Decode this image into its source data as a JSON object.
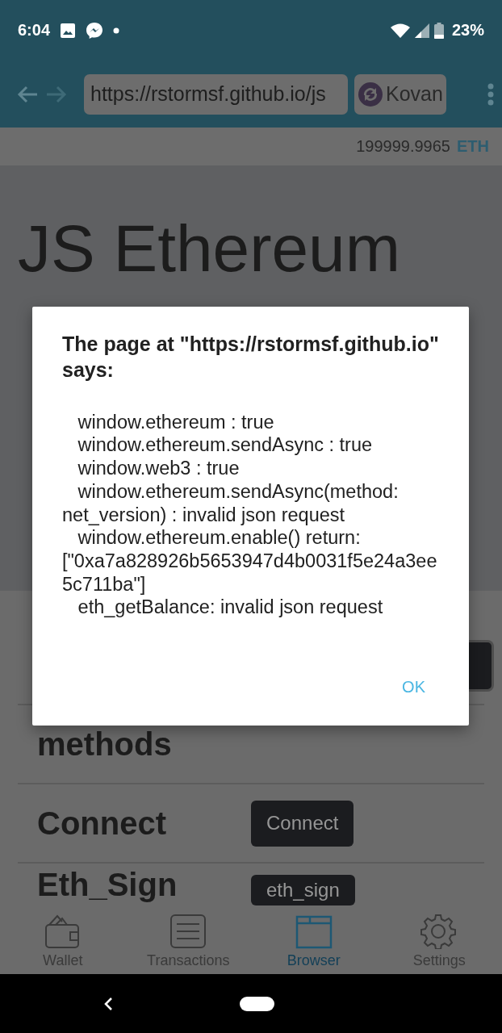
{
  "status_bar": {
    "time": "6:04",
    "battery": "23%"
  },
  "toolbar": {
    "url": "https://rstormsf.github.io/js",
    "network": "Kovan"
  },
  "balance": {
    "amount": "199999.9965",
    "unit": "ETH"
  },
  "page": {
    "title": "JS Ethereum",
    "rows": [
      {
        "heading": "methods"
      },
      {
        "heading": "Connect",
        "button": "Connect"
      },
      {
        "heading": "Eth_Sign",
        "button": "eth_sign"
      }
    ]
  },
  "dialog": {
    "title": "The page at \"https://rstormsf.github.io\" says:",
    "message": "\n   window.ethereum : true\n   window.ethereum.sendAsync : true\n   window.web3 : true\n   window.ethereum.sendAsync(method: net_version) : invalid json request\n   window.ethereum.enable() return: [\"0xa7a828926b5653947d4b0031f5e24a3ee5c711ba\"]\n   eth_getBalance: invalid json request",
    "button": "OK"
  },
  "bottom_nav": [
    {
      "label": "Wallet",
      "selected": false
    },
    {
      "label": "Transactions",
      "selected": false
    },
    {
      "label": "Browser",
      "selected": true
    },
    {
      "label": "Settings",
      "selected": false
    }
  ]
}
